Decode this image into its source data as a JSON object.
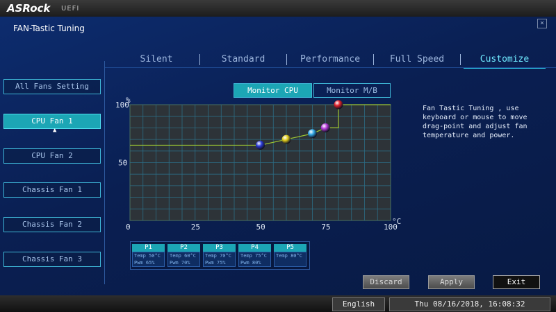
{
  "header": {
    "brand": "ASRock",
    "subtitle": "UEFI"
  },
  "page": {
    "title": "FAN-Tastic Tuning"
  },
  "tabs": [
    {
      "label": "Silent"
    },
    {
      "label": "Standard"
    },
    {
      "label": "Performance"
    },
    {
      "label": "Full Speed"
    },
    {
      "label": "Customize",
      "active": true
    }
  ],
  "sidebar": {
    "items": [
      {
        "label": "All Fans Setting"
      },
      {
        "label": "CPU Fan 1",
        "active": true
      },
      {
        "label": "CPU Fan 2"
      },
      {
        "label": "Chassis Fan 1"
      },
      {
        "label": "Chassis Fan 2"
      },
      {
        "label": "Chassis Fan 3"
      }
    ]
  },
  "monitor": {
    "cpu": "Monitor CPU",
    "mb": "Monitor M/B",
    "active": "cpu"
  },
  "chart_data": {
    "type": "line",
    "xlabel": "°C",
    "ylabel": "%",
    "xlim": [
      0,
      100
    ],
    "ylim": [
      0,
      100
    ],
    "x_ticks": [
      "0",
      "25",
      "50",
      "75",
      "100"
    ],
    "y_ticks": [
      "50",
      "100"
    ],
    "grid": true,
    "line": [
      [
        0,
        65
      ],
      [
        50,
        65
      ],
      [
        60,
        70
      ],
      [
        70,
        75
      ],
      [
        75,
        80
      ],
      [
        80,
        80
      ],
      [
        80,
        100
      ],
      [
        100,
        100
      ]
    ],
    "points": [
      {
        "name": "P1",
        "x": 50,
        "y": 65,
        "color": "#2a3ad6"
      },
      {
        "name": "P2",
        "x": 60,
        "y": 70,
        "color": "#e0cc1a"
      },
      {
        "name": "P3",
        "x": 70,
        "y": 75,
        "color": "#2fa8e6"
      },
      {
        "name": "P4",
        "x": 75,
        "y": 80,
        "color": "#b43ad8"
      },
      {
        "name": "P5",
        "x": 80,
        "y": 100,
        "color": "#e0202a"
      }
    ]
  },
  "help_text": "Fan Tastic Tuning , use keyboard or mouse to move drag-point and adjust fan temperature and power.",
  "points_table": [
    {
      "name": "P1",
      "temp": "Temp 50°C",
      "pwm": "Pwm  65%"
    },
    {
      "name": "P2",
      "temp": "Temp 60°C",
      "pwm": "Pwm  70%"
    },
    {
      "name": "P3",
      "temp": "Temp 70°C",
      "pwm": "Pwm  75%"
    },
    {
      "name": "P4",
      "temp": "Temp 75°C",
      "pwm": "Pwm  80%"
    },
    {
      "name": "P5",
      "temp": "Temp 80°C",
      "pwm": ""
    }
  ],
  "buttons": {
    "discard": "Discard",
    "apply": "Apply",
    "exit": "Exit"
  },
  "footer": {
    "language": "English",
    "datetime": "Thu 08/16/2018, 16:08:32"
  },
  "colors": {
    "accent": "#1ca6b5",
    "tab_active": "#6fe9ff",
    "background": "#0a1f52"
  }
}
